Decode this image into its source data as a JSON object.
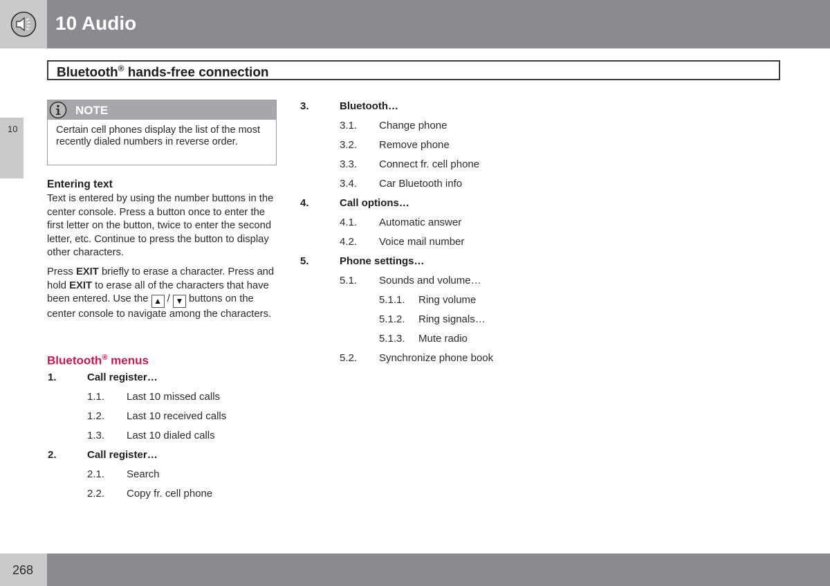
{
  "header": {
    "chapter_title": "10 Audio",
    "chapter_icon": "speaker-icon"
  },
  "section": {
    "title": "Bluetooth",
    "title_sup": "®",
    "title_rest": " hands-free connection"
  },
  "side_tab": {
    "label": "10"
  },
  "note": {
    "icon": "info-icon",
    "label": "NOTE",
    "text": "Certain cell phones display the list of the most recently dialed numbers in reverse order."
  },
  "entering_text": {
    "heading": "Entering text",
    "para1": "Text is entered by using the number buttons in the center console. Press a button once to enter the first letter on the button, twice to enter the second letter, etc. Continue to press the button to display other characters.",
    "para2_a": "Press ",
    "para2_b": "EXIT",
    "para2_c": " briefly to erase a character. Press and hold ",
    "para2_d": "EXIT",
    "para2_e": " to erase all of the characters that have been entered. Use the ",
    "up_key": "▲",
    "slash": " / ",
    "down_key": "▼",
    "para2_f": " buttons on the center console to navigate among the characters."
  },
  "menus": {
    "heading": "Bluetooth",
    "heading_sup": "®",
    "heading_rest": " menus",
    "items": [
      {
        "num": "1.",
        "label": "Call register…",
        "level": 1
      },
      {
        "num": "1.1.",
        "label": "Last 10 missed calls",
        "level": 2
      },
      {
        "num": "1.2.",
        "label": "Last 10 received calls",
        "level": 2
      },
      {
        "num": "1.3.",
        "label": "Last 10 dialed calls",
        "level": 2
      },
      {
        "num": "2.",
        "label": "Call register…",
        "level": 1
      },
      {
        "num": "2.1.",
        "label": "Search",
        "level": 2
      },
      {
        "num": "2.2.",
        "label": "Copy fr. cell phone",
        "level": 2
      },
      {
        "num": "3.",
        "label": "Bluetooth…",
        "level": 1
      },
      {
        "num": "3.1.",
        "label": "Change phone",
        "level": 2
      },
      {
        "num": "3.2.",
        "label": "Remove phone",
        "level": 2
      },
      {
        "num": "3.3.",
        "label": "Connect fr. cell phone",
        "level": 2
      },
      {
        "num": "3.4.",
        "label": "Car Bluetooth info",
        "level": 2
      },
      {
        "num": "4.",
        "label": "Call options…",
        "level": 1
      },
      {
        "num": "4.1.",
        "label": "Automatic answer",
        "level": 2
      },
      {
        "num": "4.2.",
        "label": "Voice mail number",
        "level": 2
      },
      {
        "num": "5.",
        "label": "Phone settings…",
        "level": 1
      },
      {
        "num": "5.1.",
        "label": "Sounds and volume…",
        "level": 2
      },
      {
        "num": "5.1.1.",
        "label": "Ring volume",
        "level": 3
      },
      {
        "num": "5.1.2.",
        "label": "Ring signals…",
        "level": 3
      },
      {
        "num": "5.1.3.",
        "label": "Mute radio",
        "level": 3
      },
      {
        "num": "5.2.",
        "label": "Synchronize phone book",
        "level": 2
      }
    ]
  },
  "footer": {
    "page_number": "268"
  },
  "colors": {
    "accent": "#c3194b",
    "header_gray": "#8a8b8f",
    "light_gray": "#c9cacc"
  }
}
